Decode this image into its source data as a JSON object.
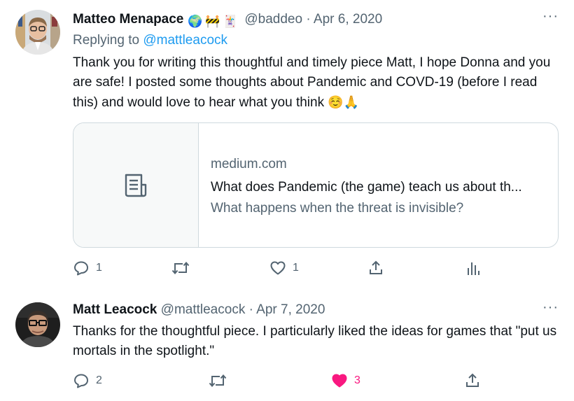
{
  "tweets": [
    {
      "author_name": "Matteo Menapace",
      "badges": [
        "🌍",
        "🚧",
        "🃏"
      ],
      "handle": "@baddeo",
      "separator": "·",
      "date": "Apr 6, 2020",
      "more_label": "···",
      "replying_prefix": "Replying to",
      "replying_to": "@mattleacock",
      "text": "Thank you for writing this thoughtful and timely piece Matt, I hope Donna and you are safe! I posted some thoughts about Pandemic and COVD-19 (before I read this) and would love to hear what you think",
      "text_emoji": "☺️🙏",
      "card": {
        "domain": "medium.com",
        "title": "What does Pandemic (the game) teach us about th...",
        "description": "What happens when the threat is invisible?",
        "icon": "article-icon"
      },
      "actions": {
        "reply_count": "1",
        "retweet_count": "",
        "like_count": "1"
      }
    },
    {
      "author_name": "Matt Leacock",
      "handle": "@mattleacock",
      "separator": "·",
      "date": "Apr 7, 2020",
      "more_label": "···",
      "text": "Thanks for the thoughtful piece. I particularly liked the ideas for games that \"put us mortals in the spotlight.\"",
      "actions": {
        "reply_count": "2",
        "retweet_count": "",
        "like_count": "3",
        "liked": true
      }
    }
  ],
  "colors": {
    "text": "#0f1419",
    "secondary": "#536471",
    "link": "#1d9bf0",
    "like_active": "#f91880",
    "border": "#cfd9de"
  }
}
